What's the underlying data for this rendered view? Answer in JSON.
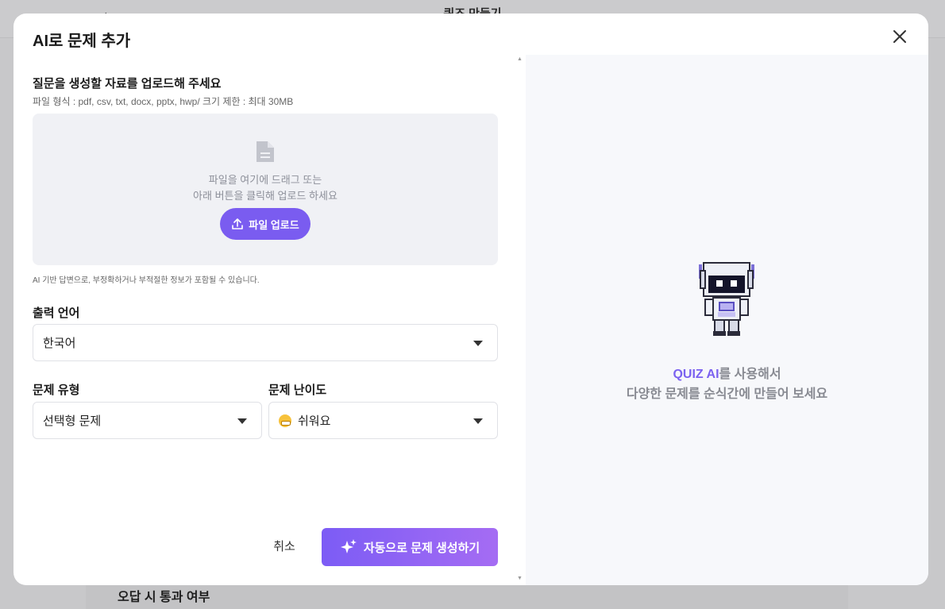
{
  "background": {
    "page_title": "퀴즈 만들기",
    "section_label": "오답 시 통과 여부"
  },
  "modal": {
    "title": "AI로 문제 추가",
    "upload": {
      "label": "질문을 생성할 자료를 업로드해 주세요",
      "file_format": "파일 형식 : pdf, csv, txt, docx, pptx, hwp/ 크기 제한 : 최대 30MB",
      "drop_line1": "파일을 여기에 드래그 또는",
      "drop_line2": "아래 버튼을 클릭해 업로드 하세요",
      "button_label": "파일 업로드"
    },
    "ai_notice": "AI 기반 답변으로, 부정확하거나 부적절한 정보가 포함될 수 있습니다.",
    "output_language": {
      "label": "출력 언어",
      "value": "한국어"
    },
    "question_type": {
      "label": "문제 유형",
      "value": "선택형 문제"
    },
    "difficulty": {
      "label": "문제 난이도",
      "value": "쉬워요",
      "emoji": "grinning-face-icon"
    },
    "cancel_label": "취소",
    "generate_label": "자동으로 문제 생성하기",
    "promo": {
      "accent": "QUIZ AI",
      "line1_rest": "를 사용해서",
      "line2": "다양한 문제를 순식간에 만들어 보세요"
    }
  },
  "colors": {
    "accent": "#7a5cf0",
    "gradient_end": "#a56cf3",
    "dropzone_bg": "#f0f1f5",
    "right_panel_bg": "#f7f8fb"
  }
}
